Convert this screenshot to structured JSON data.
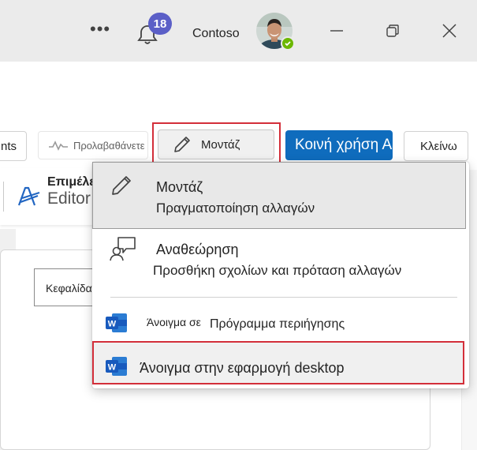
{
  "titlebar": {
    "more_label": "•••",
    "notification_count": "18",
    "org_name": "Contoso",
    "presence_status": "available",
    "presence_color": "#6bb700",
    "badge_color": "#5b5fc7"
  },
  "ribbon": {
    "partial_comments_label": "nts",
    "preview_label": "Προλαβαθάνετε",
    "edit_label": "Μοντάζ",
    "share_label": "Κοινή χρήση Α",
    "close_label": "Κλείνω",
    "editor_group_title": "Επιμέλεια",
    "editor_label": "Editor",
    "accent_color": "#0f6cbd",
    "highlight_color": "#d32f3a"
  },
  "document": {
    "header_label": "Κεφαλίδα"
  },
  "menu": {
    "items": [
      {
        "title": "Μοντάζ",
        "subtitle": "Πραγματοποίηση αλλαγών",
        "icon": "pencil-icon"
      },
      {
        "title": "Αναθεώρηση",
        "subtitle": "Προσθήκη σχολίων και πρόταση αλλαγών",
        "icon": "review-comment-icon"
      },
      {
        "title_prefix": "Άνοιγμα σε",
        "title_suffix": "Πρόγραμμα περιήγησης",
        "icon": "word-icon"
      },
      {
        "title": "Άνοιγμα στην εφαρμογή desktop",
        "icon": "word-icon"
      }
    ]
  }
}
